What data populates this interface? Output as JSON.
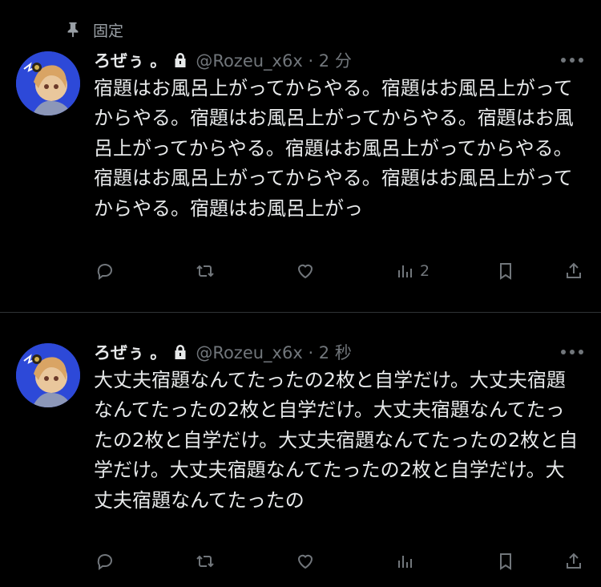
{
  "pinned_label": "固定",
  "tweets": [
    {
      "name": "ろぜぅ 。",
      "handle_time": "@Rozeu_x6x · 2 分",
      "text": "宿題はお風呂上がってからやる。宿題はお風呂上がってからやる。宿題はお風呂上がってからやる。宿題はお風呂上がってからやる。宿題はお風呂上がってからやる。宿題はお風呂上がってからやる。宿題はお風呂上がってからやる。宿題はお風呂上がっ",
      "views_count": "2"
    },
    {
      "name": "ろぜぅ 。",
      "handle_time": "@Rozeu_x6x · 2 秒",
      "text": "大丈夫宿題なんてたったの2枚と自学だけ。大丈夫宿題なんてたったの2枚と自学だけ。大丈夫宿題なんてたったの2枚と自学だけ。大丈夫宿題なんてたったの2枚と自学だけ。大丈夫宿題なんてたったの2枚と自学だけ。大丈夫宿題なんてたったの",
      "views_count": ""
    }
  ],
  "icons": [
    "pin-icon",
    "lock-icon",
    "more-icon",
    "reply-icon",
    "retweet-icon",
    "like-icon",
    "views-icon",
    "bookmark-icon",
    "share-icon"
  ],
  "colors": {
    "background": "#000000",
    "text": "#e7e9ea",
    "muted": "#71767b",
    "divider": "#2f3336"
  }
}
